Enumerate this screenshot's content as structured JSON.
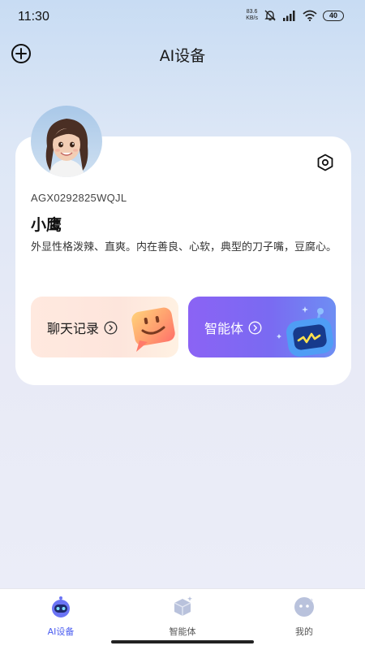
{
  "status_bar": {
    "time": "11:30",
    "net_speed_value": "83.6",
    "net_speed_unit": "KB/s",
    "battery": "40",
    "icons": [
      "mute-bell-icon",
      "signal-icon",
      "wifi-icon",
      "battery-icon"
    ]
  },
  "header": {
    "title": "AI设备",
    "add_icon": "plus-circle-icon"
  },
  "device": {
    "id": "AGX0292825WQJL",
    "name": "小鹰",
    "description": "外显性格泼辣、直爽。内在善良、心软，典型的刀子嘴，豆腐心。",
    "settings_icon": "hexagon-settings-icon"
  },
  "actions": {
    "chat_history_label": "聊天记录",
    "agent_label": "智能体"
  },
  "bottom_nav": {
    "items": [
      {
        "label": "AI设备",
        "icon": "robot-icon",
        "active": true
      },
      {
        "label": "智能体",
        "icon": "cube-icon",
        "active": false
      },
      {
        "label": "我的",
        "icon": "face-icon",
        "active": false
      }
    ]
  },
  "colors": {
    "accent": "#4a5cf0",
    "agent_gradient_start": "#8b63f4",
    "agent_gradient_end": "#6e8ef3",
    "chat_bg": "#ffe9df"
  }
}
